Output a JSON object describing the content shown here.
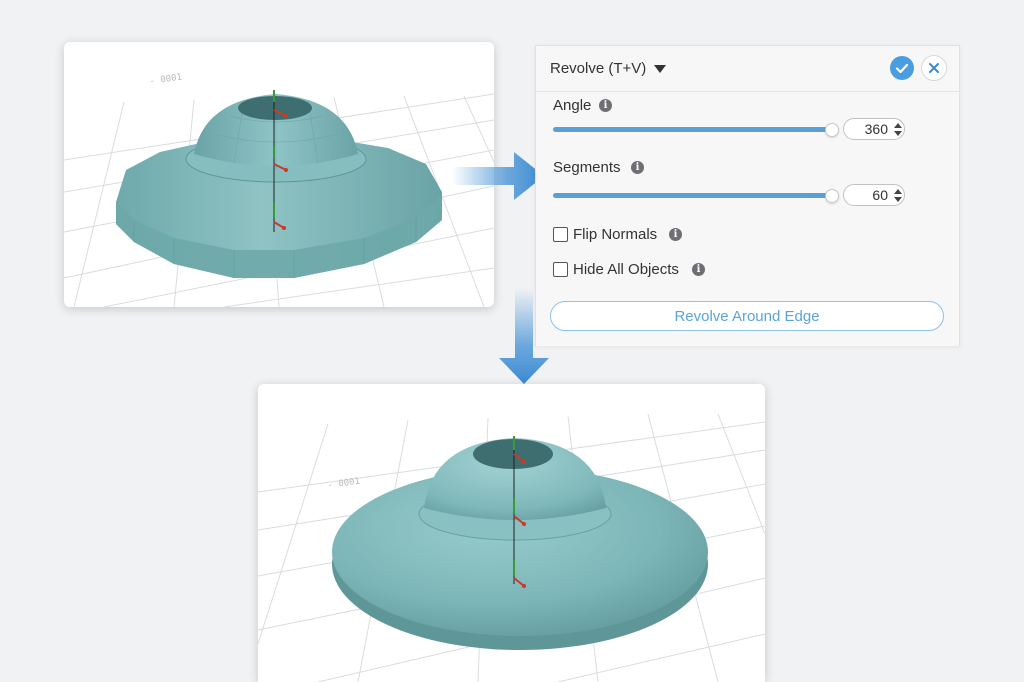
{
  "panel": {
    "title": "Revolve (T+V)",
    "confirm_icon": "checkmark-icon",
    "cancel_icon": "close-icon",
    "angle": {
      "label": "Angle",
      "value": "360",
      "slider_fraction": 1.0
    },
    "segments": {
      "label": "Segments",
      "value": "60",
      "slider_fraction": 1.0
    },
    "flip_normals": {
      "label": "Flip Normals",
      "checked": false
    },
    "hide_all_objects": {
      "label": "Hide All Objects",
      "checked": false
    },
    "action_button": "Revolve Around Edge",
    "info_glyph": "i"
  },
  "viewports": {
    "before": {
      "model": "low-poly revolved saucer",
      "model_color": "#78b3b5"
    },
    "after": {
      "model": "smooth revolved saucer",
      "model_color": "#7bb5b8"
    }
  },
  "colors": {
    "accent": "#4a9ee0",
    "slider": "#5a9fd6",
    "arrow": "#4a95d6"
  }
}
